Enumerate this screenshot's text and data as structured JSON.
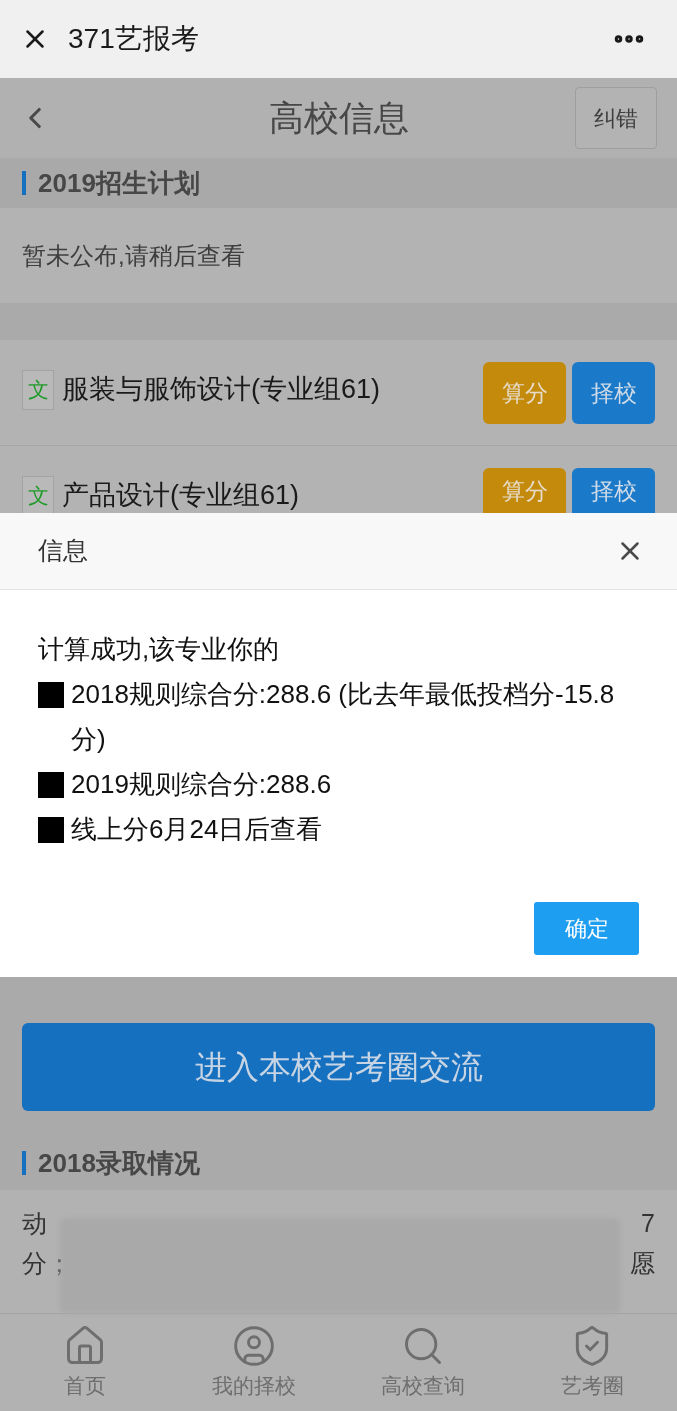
{
  "top_bar": {
    "title": "371艺报考"
  },
  "header": {
    "title": "高校信息",
    "action": "纠错"
  },
  "plan_section": {
    "title": "2019招生计划",
    "notice": "暂未公布,请稍后查看"
  },
  "majors": [
    {
      "badge": "文",
      "name": "服装与服饰设计(专业组61)",
      "buttons": [
        "算分",
        "择校"
      ]
    },
    {
      "badge": "文",
      "name": "产品设计(专业组61)",
      "buttons": [
        "算分",
        "择校"
      ]
    }
  ],
  "dialog": {
    "title": "信息",
    "intro": "计算成功,该专业你的",
    "items": [
      "2018规则综合分:288.6 (比去年最低投档分-15.8分)",
      "2019规则综合分:288.6",
      "线上分6月24日后查看"
    ],
    "confirm": "确定"
  },
  "join_button": "进入本校艺考圈交流",
  "admission_section": {
    "title": "2018录取情况",
    "lines": [
      {
        "start": "动",
        "end": "7"
      },
      {
        "start": "分；",
        "end": "愿"
      }
    ]
  },
  "tab_bar": [
    {
      "label": "首页",
      "selected": false
    },
    {
      "label": "我的择校",
      "selected": false
    },
    {
      "label": "高校查询",
      "selected": false
    },
    {
      "label": "艺考圈",
      "selected": false
    }
  ]
}
